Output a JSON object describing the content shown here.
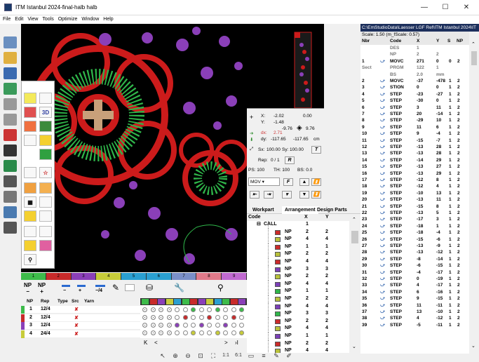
{
  "window": {
    "title": "ITM Istanbul 2024-final-halb halb",
    "minimize": "—",
    "maximize": "☐",
    "close": "✕"
  },
  "menu": [
    "File",
    "Edit",
    "View",
    "Tools",
    "Optimize",
    "Window",
    "Help"
  ],
  "canvas": {
    "bg": "#000000",
    "red": "#cc1b1b",
    "green": "#2fb64a",
    "purple": "#8a3fb8",
    "tan": "#c8a07a"
  },
  "coords": {
    "x_label": "X:",
    "x_val": "-2.02",
    "y_label": "Y:",
    "y_val": "-1.48",
    "x2": "0.00",
    "left_val": "-9.76",
    "right_val": "9.76",
    "dx_label": "dx:",
    "dx_val": "2.71",
    "dy_label": "dy:",
    "dy_val": "-117.65",
    "dy2": "-117.65",
    "unit": "cm",
    "sx_label": "Sx:",
    "sx_val": "100.00",
    "sy_label": "Sy:",
    "sy_val": "100.00",
    "t_btn": "T",
    "rep_label": "Rep:",
    "rep_val": "0 / 1",
    "r_btn": "R",
    "ps": "PS: 100",
    "th": "TH: 100",
    "bs": "BS: 0.0",
    "mov": "MOV",
    "f_btn": "F"
  },
  "tabs": [
    "Workpart",
    "Arrangement",
    "Design Parts"
  ],
  "arr_header": {
    "code": "Code",
    "x": "X",
    "y": "Y"
  },
  "arrangement": [
    {
      "code": "CALL",
      "x": "1",
      "y": "",
      "color": ""
    },
    {
      "code": "NP",
      "x": "2",
      "y": "2",
      "color": "#cc2a2a"
    },
    {
      "code": "NP",
      "x": "4",
      "y": "4",
      "color": "#b8c13a"
    },
    {
      "code": "NP",
      "x": "1",
      "y": "1",
      "color": "#cc2a2a"
    },
    {
      "code": "NP",
      "x": "2",
      "y": "2",
      "color": "#b8c13a"
    },
    {
      "code": "NP",
      "x": "4",
      "y": "4",
      "color": "#cc2a2a"
    },
    {
      "code": "NP",
      "x": "3",
      "y": "3",
      "color": "#7b3fb8"
    },
    {
      "code": "NP",
      "x": "2",
      "y": "2",
      "color": "#b8c13a"
    },
    {
      "code": "NP",
      "x": "4",
      "y": "4",
      "color": "#7b3fb8"
    },
    {
      "code": "NP",
      "x": "1",
      "y": "1",
      "color": "#2fb64a"
    },
    {
      "code": "NP",
      "x": "2",
      "y": "2",
      "color": "#b8c13a"
    },
    {
      "code": "NP",
      "x": "4",
      "y": "4",
      "color": "#7b3fb8"
    },
    {
      "code": "NP",
      "x": "3",
      "y": "3",
      "color": "#2fb64a"
    },
    {
      "code": "NP",
      "x": "2",
      "y": "2",
      "color": "#cc2a2a"
    },
    {
      "code": "NP",
      "x": "4",
      "y": "4",
      "color": "#b8c13a"
    },
    {
      "code": "NP",
      "x": "1",
      "y": "1",
      "color": "#7b3fb8"
    },
    {
      "code": "NP",
      "x": "2",
      "y": "2",
      "color": "#cc2a2a"
    },
    {
      "code": "NP",
      "x": "4",
      "y": "4",
      "color": "#b8c13a"
    }
  ],
  "rightpanel": {
    "path": "C:\\EmStudioData\\Laesser  LGF  Ref\\ITM Istanbul 2024\\IT",
    "scale": "Scale: 1.50 (m_fScale: 0.57)",
    "headers": [
      "Nbr",
      "Code",
      "X",
      "Y",
      "S",
      "NP"
    ]
  },
  "stitches": [
    {
      "nbr": "",
      "code": "DES",
      "x": "1",
      "y": "",
      "s": "",
      "np": ""
    },
    {
      "nbr": "",
      "code": "NP",
      "x": "2",
      "y": "2",
      "s": "",
      "np": ""
    },
    {
      "nbr": "1",
      "code": "MOVC",
      "x": "271",
      "y": "0",
      "s": "0",
      "np": "2"
    },
    {
      "nbr": "Sect",
      "code": "PRGM",
      "x": "122",
      "y": "1",
      "s": "",
      "np": ""
    },
    {
      "nbr": "",
      "code": "BS",
      "x": "2.0",
      "y": "mm",
      "s": "",
      "np": ""
    },
    {
      "nbr": "2",
      "code": "MOVC",
      "x": "-37",
      "y": "-478",
      "s": "1",
      "np": "2"
    },
    {
      "nbr": "3",
      "code": "STION",
      "x": "0",
      "y": "0",
      "s": "1",
      "np": "2"
    },
    {
      "nbr": "4",
      "code": "STEP",
      "x": "-23",
      "y": "-27",
      "s": "1",
      "np": "2"
    },
    {
      "nbr": "5",
      "code": "STEP",
      "x": "-30",
      "y": "0",
      "s": "1",
      "np": "2"
    },
    {
      "nbr": "6",
      "code": "STEP",
      "x": "3",
      "y": "11",
      "s": "1",
      "np": "2"
    },
    {
      "nbr": "7",
      "code": "STEP",
      "x": "20",
      "y": "-14",
      "s": "1",
      "np": "2"
    },
    {
      "nbr": "8",
      "code": "STEP",
      "x": "-29",
      "y": "10",
      "s": "1",
      "np": "2"
    },
    {
      "nbr": "9",
      "code": "STEP",
      "x": "11",
      "y": "6",
      "s": "1",
      "np": "2"
    },
    {
      "nbr": "10",
      "code": "STEP",
      "x": "9",
      "y": "-4",
      "s": "1",
      "np": "2"
    },
    {
      "nbr": "11",
      "code": "STEP",
      "x": "-15",
      "y": "-7",
      "s": "1",
      "np": "2"
    },
    {
      "nbr": "12",
      "code": "STEP",
      "x": "-13",
      "y": "28",
      "s": "1",
      "np": "2"
    },
    {
      "nbr": "13",
      "code": "STEP",
      "x": "-13",
      "y": "28",
      "s": "1",
      "np": "2"
    },
    {
      "nbr": "14",
      "code": "STEP",
      "x": "-14",
      "y": "29",
      "s": "1",
      "np": "2"
    },
    {
      "nbr": "15",
      "code": "STEP",
      "x": "-13",
      "y": "27",
      "s": "1",
      "np": "2"
    },
    {
      "nbr": "16",
      "code": "STEP",
      "x": "-13",
      "y": "29",
      "s": "1",
      "np": "2"
    },
    {
      "nbr": "17",
      "code": "STEP",
      "x": "-12",
      "y": "8",
      "s": "1",
      "np": "2"
    },
    {
      "nbr": "18",
      "code": "STEP",
      "x": "-12",
      "y": "4",
      "s": "1",
      "np": "2"
    },
    {
      "nbr": "19",
      "code": "STEP",
      "x": "-10",
      "y": "13",
      "s": "1",
      "np": "2"
    },
    {
      "nbr": "20",
      "code": "STEP",
      "x": "-13",
      "y": "11",
      "s": "1",
      "np": "2"
    },
    {
      "nbr": "21",
      "code": "STEP",
      "x": "-15",
      "y": "8",
      "s": "1",
      "np": "2"
    },
    {
      "nbr": "22",
      "code": "STEP",
      "x": "-13",
      "y": "5",
      "s": "1",
      "np": "2"
    },
    {
      "nbr": "23",
      "code": "STEP",
      "x": "-17",
      "y": "3",
      "s": "1",
      "np": "2"
    },
    {
      "nbr": "24",
      "code": "STEP",
      "x": "-18",
      "y": "1",
      "s": "1",
      "np": "2"
    },
    {
      "nbr": "25",
      "code": "STEP",
      "x": "-18",
      "y": "-4",
      "s": "1",
      "np": "2"
    },
    {
      "nbr": "26",
      "code": "STEP",
      "x": "-15",
      "y": "-6",
      "s": "1",
      "np": "2"
    },
    {
      "nbr": "27",
      "code": "STEP",
      "x": "-13",
      "y": "-9",
      "s": "1",
      "np": "2"
    },
    {
      "nbr": "28",
      "code": "STEP",
      "x": "-13",
      "y": "-12",
      "s": "1",
      "np": "2"
    },
    {
      "nbr": "29",
      "code": "STEP",
      "x": "-8",
      "y": "-14",
      "s": "1",
      "np": "2"
    },
    {
      "nbr": "30",
      "code": "STEP",
      "x": "-6",
      "y": "-15",
      "s": "1",
      "np": "2"
    },
    {
      "nbr": "31",
      "code": "STEP",
      "x": "-4",
      "y": "-17",
      "s": "1",
      "np": "2"
    },
    {
      "nbr": "32",
      "code": "STEP",
      "x": "0",
      "y": "-19",
      "s": "1",
      "np": "2"
    },
    {
      "nbr": "33",
      "code": "STEP",
      "x": "4",
      "y": "-17",
      "s": "1",
      "np": "2"
    },
    {
      "nbr": "34",
      "code": "STEP",
      "x": "6",
      "y": "-16",
      "s": "1",
      "np": "2"
    },
    {
      "nbr": "35",
      "code": "STEP",
      "x": "9",
      "y": "-15",
      "s": "1",
      "np": "2"
    },
    {
      "nbr": "36",
      "code": "STEP",
      "x": "11",
      "y": "-11",
      "s": "1",
      "np": "2"
    },
    {
      "nbr": "37",
      "code": "STEP",
      "x": "13",
      "y": "-10",
      "s": "1",
      "np": "2"
    },
    {
      "nbr": "38",
      "code": "STEP",
      "x": "4",
      "y": "-12",
      "s": "1",
      "np": "2"
    },
    {
      "nbr": "39",
      "code": "STEP",
      "x": "-5",
      "y": "-11",
      "s": "1",
      "np": "2"
    }
  ],
  "colorbar": [
    {
      "label": "1",
      "color": "#3dbb4a"
    },
    {
      "label": "2",
      "color": "#c82a2a"
    },
    {
      "label": "3",
      "color": "#8a3fb8"
    },
    {
      "label": "4",
      "color": "#c7cc3a"
    },
    {
      "label": "5",
      "color": "#2a9fd0"
    },
    {
      "label": "6",
      "color": "#2a9fd0"
    },
    {
      "label": "7",
      "color": "#7a8fc8"
    },
    {
      "label": "8",
      "color": "#e07a8a"
    },
    {
      "label": "9",
      "color": "#c06ad0"
    }
  ],
  "yarntb": {
    "np_minus": "NP",
    "np_plus": "NP",
    "minus": "−",
    "plus": "+",
    "minus4": "−/4"
  },
  "yarn_header": {
    "np": "NP",
    "rep": "Rep",
    "type": "Type",
    "src": "Src",
    "yarn": "Yarn"
  },
  "yarns": [
    {
      "np": "1",
      "rep": "12/4",
      "mark": "✘",
      "color": "#3dbb4a"
    },
    {
      "np": "2",
      "rep": "12/4",
      "mark": "✘",
      "color": "#c82a2a"
    },
    {
      "np": "3",
      "rep": "12/4",
      "mark": "✘",
      "color": "#8a3fb8"
    },
    {
      "np": "4",
      "rep": "24/4",
      "mark": "✘",
      "color": "#c7cc3a"
    }
  ],
  "grid_header": [
    "1",
    "",
    "",
    "",
    "",
    "",
    "",
    "",
    "",
    "10"
  ],
  "nav": {
    "first": "K",
    "prev": "<",
    "next": ">",
    "last": "›I"
  }
}
